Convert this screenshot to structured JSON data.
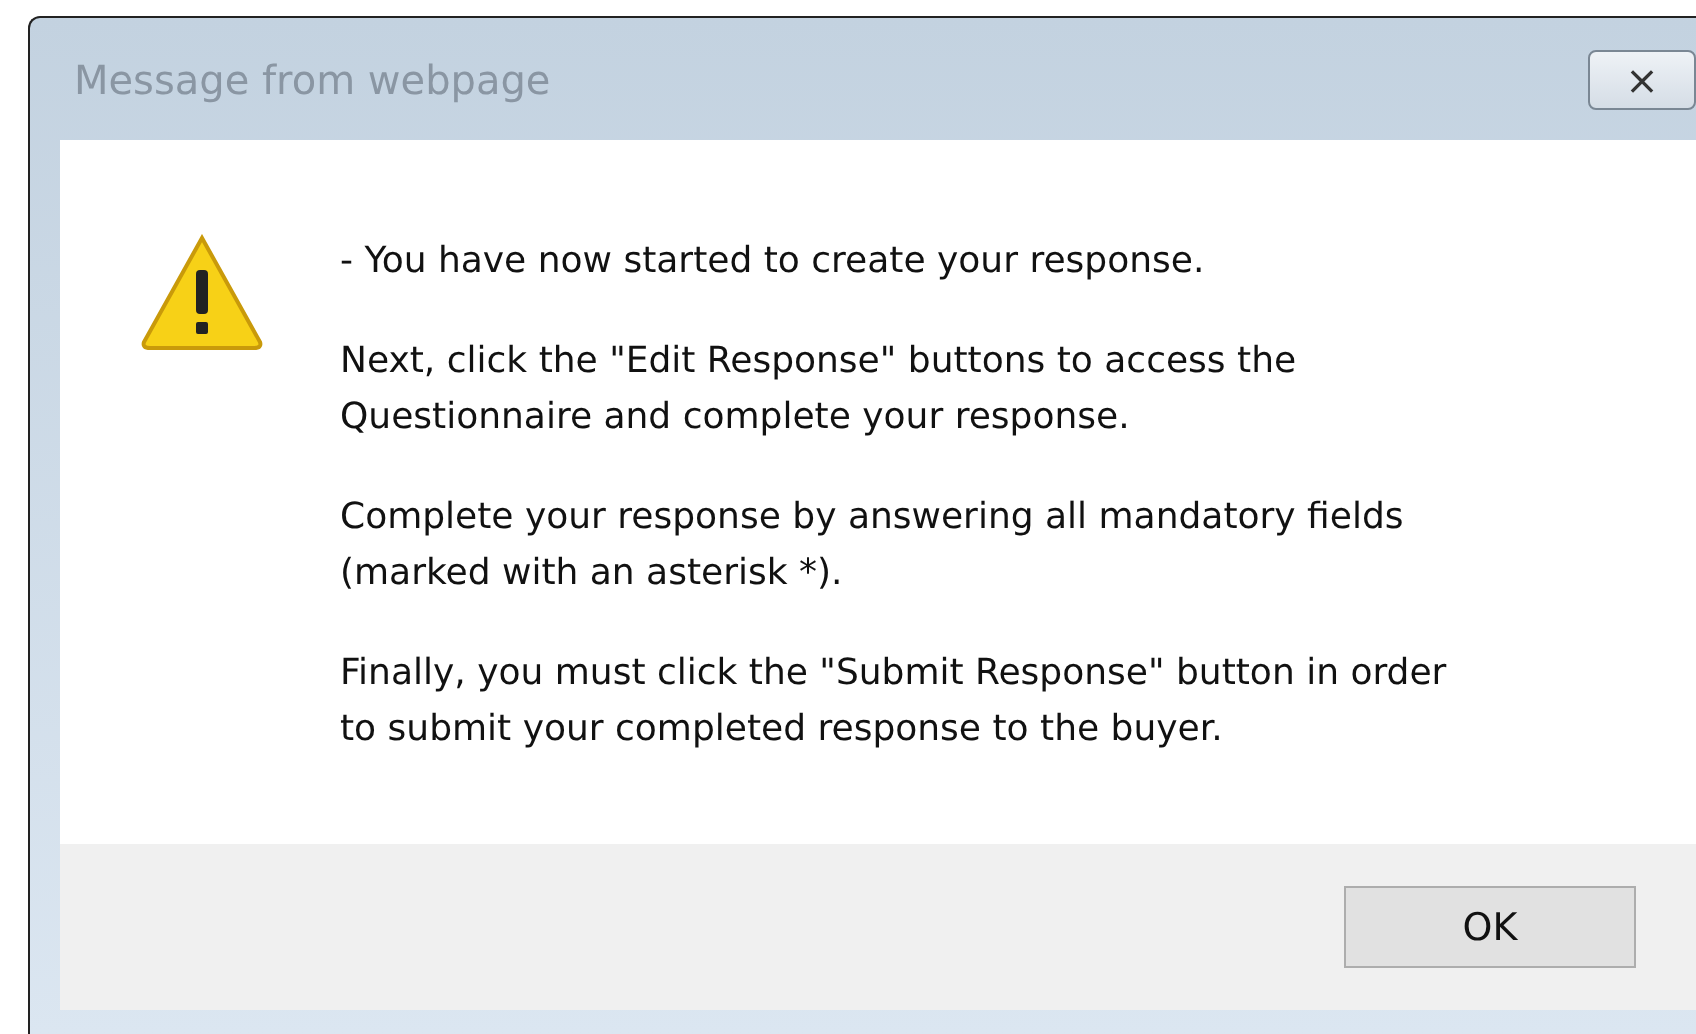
{
  "window": {
    "title": "Message from webpage",
    "close_button": "⨯"
  },
  "message": {
    "paragraphs": [
      [
        "- You have now started to create your response."
      ],
      [
        "Next, click the \"Edit Response\" buttons to access the",
        "Questionnaire and complete your response."
      ],
      [
        "Complete your response by answering all mandatory fields",
        "(marked with an asterisk *)."
      ],
      [
        "Finally, you must click the \"Submit Response\" button in order",
        "to submit your completed response to the buyer."
      ]
    ]
  },
  "buttons": [
    "OK"
  ]
}
